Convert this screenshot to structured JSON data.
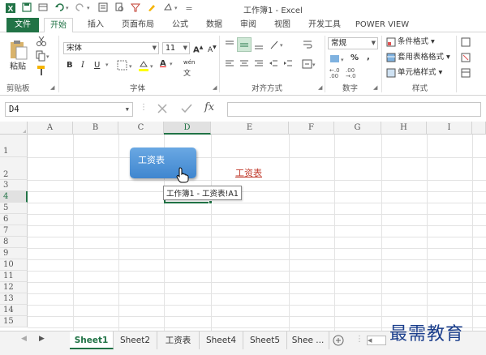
{
  "window": {
    "title": "工作簿1 - Excel",
    "quick_access": [
      "save-icon",
      "undo-icon",
      "redo-icon"
    ]
  },
  "tabs": [
    {
      "label": "文件"
    },
    {
      "label": "开始"
    },
    {
      "label": "插入"
    },
    {
      "label": "页面布局"
    },
    {
      "label": "公式"
    },
    {
      "label": "数据"
    },
    {
      "label": "审阅"
    },
    {
      "label": "视图"
    },
    {
      "label": "开发工具"
    },
    {
      "label": "POWER VIEW"
    }
  ],
  "ribbon": {
    "clipboard": {
      "label": "剪贴板",
      "paste_label": "粘贴"
    },
    "font": {
      "label": "字体",
      "font_name": "宋体",
      "font_size": "11",
      "bold": "B",
      "italic": "I",
      "underline": "U",
      "grow": "A",
      "shrink": "A",
      "color_a": "A",
      "phonetic": "wén"
    },
    "alignment": {
      "label": "对齐方式"
    },
    "number": {
      "label": "数字",
      "format": "常规",
      "percent": "%",
      "comma": ","
    },
    "styles": {
      "label": "样式",
      "conditional": "条件格式",
      "table": "套用表格格式",
      "cell": "单元格样式"
    }
  },
  "formula_bar": {
    "name_box": "D4",
    "fx": "fx"
  },
  "grid": {
    "columns": [
      "A",
      "B",
      "C",
      "D",
      "E",
      "F",
      "G",
      "H",
      "I"
    ],
    "rows": [
      "1",
      "2",
      "3",
      "4",
      "5",
      "6",
      "7",
      "8",
      "9",
      "10",
      "11",
      "12",
      "13",
      "14",
      "15"
    ],
    "selected_cell": "D4",
    "link_text": "工资表",
    "shape_text": "工资表",
    "tooltip": "工作簿1 - 工资表!A1"
  },
  "sheets": [
    "Sheet1",
    "Sheet2",
    "工资表",
    "Sheet4",
    "Sheet5",
    "Shee ..."
  ],
  "active_sheet": "Sheet1",
  "watermark": "最需教育",
  "colors": {
    "accent": "#217346",
    "link": "#c0392b",
    "shape": "#4a8fd6"
  }
}
